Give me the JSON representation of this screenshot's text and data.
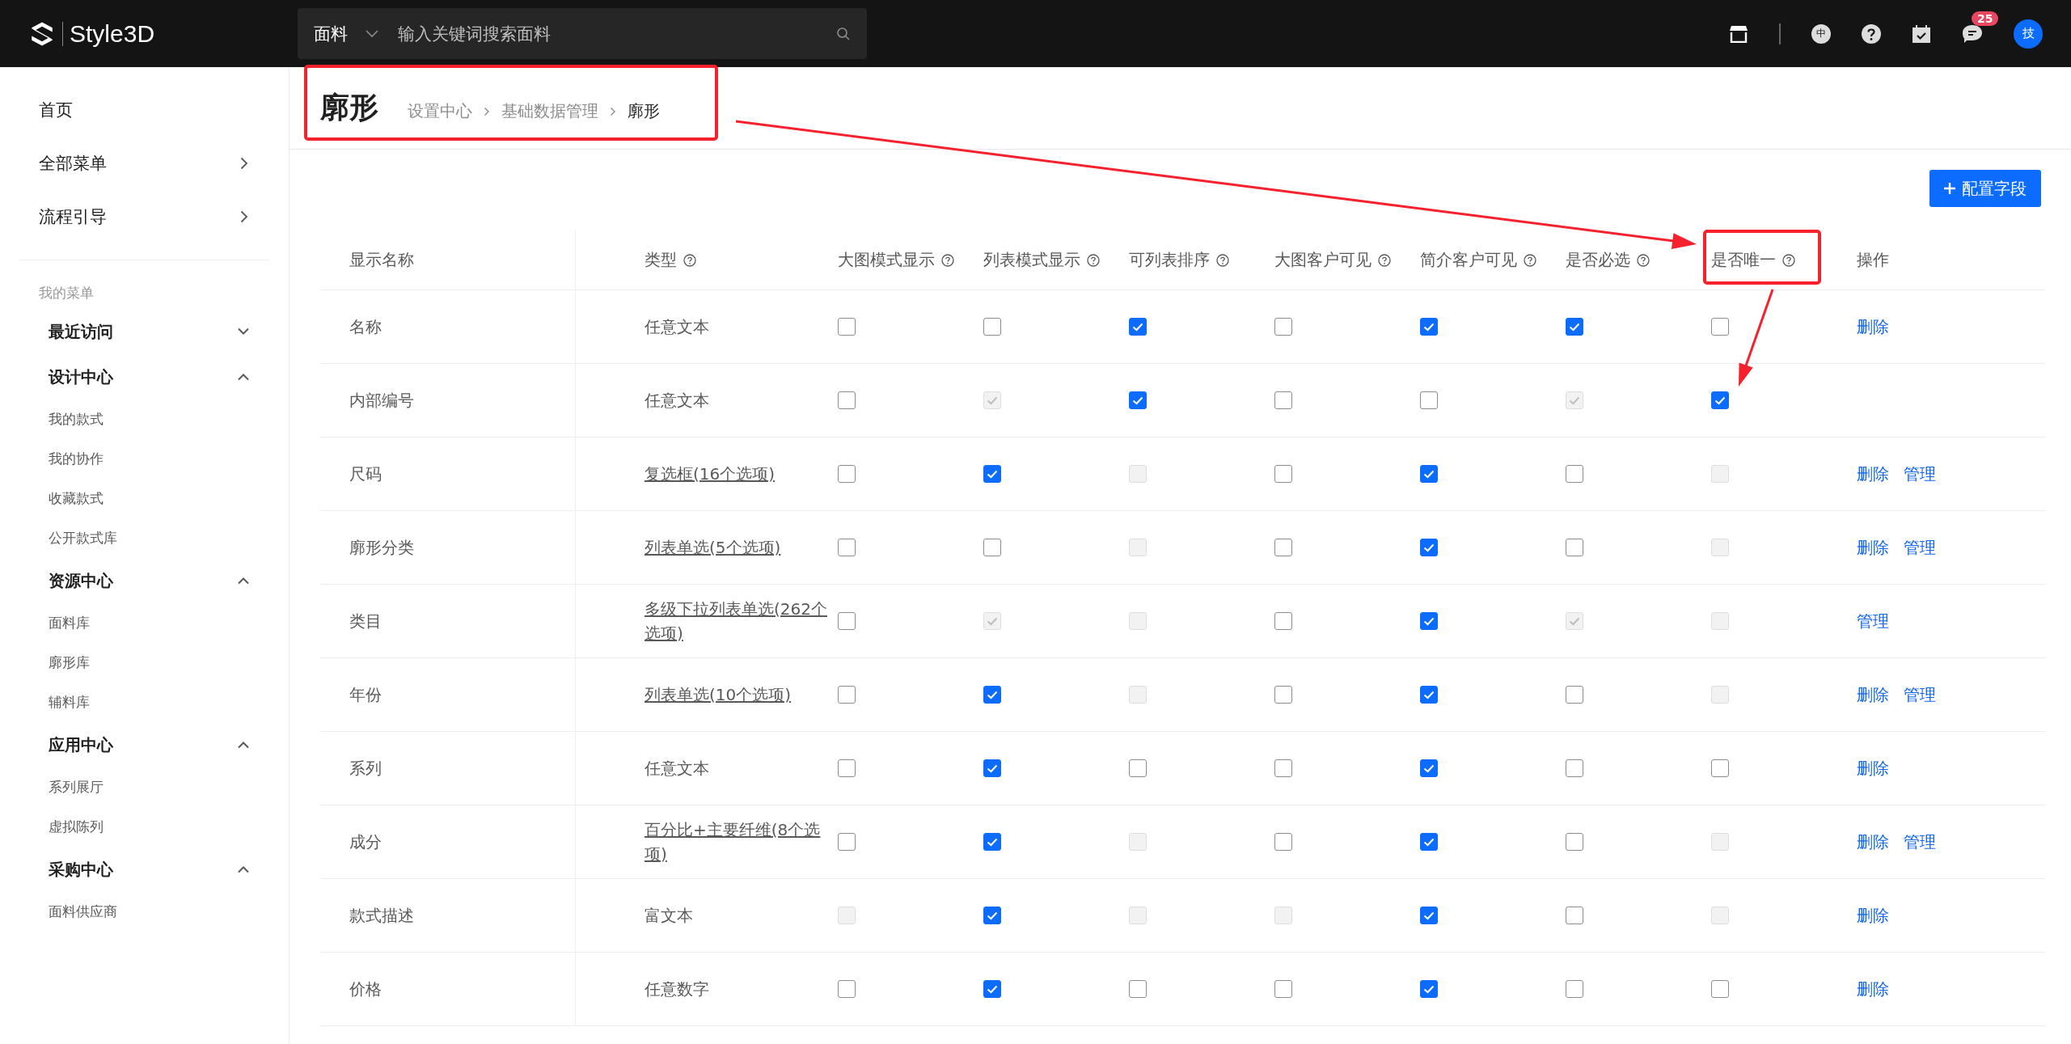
{
  "topbar": {
    "brand": "Style3D",
    "search": {
      "category": "面料",
      "placeholder": "输入关键词搜索面料"
    },
    "language": "中",
    "notification_count": "25",
    "avatar": "技"
  },
  "sidebar": {
    "top_items": [
      {
        "label": "首页",
        "has_arrow": false
      },
      {
        "label": "全部菜单",
        "has_arrow": true
      },
      {
        "label": "流程引导",
        "has_arrow": true
      }
    ],
    "section_title": "我的菜单",
    "groups": [
      {
        "label": "最近访问",
        "expanded": false
      },
      {
        "label": "设计中心",
        "expanded": true,
        "children": [
          "我的款式",
          "我的协作",
          "收藏款式",
          "公开款式库"
        ]
      },
      {
        "label": "资源中心",
        "expanded": true,
        "children": [
          "面料库",
          "廓形库",
          "辅料库"
        ]
      },
      {
        "label": "应用中心",
        "expanded": true,
        "children": [
          "系列展厅",
          "虚拟陈列"
        ]
      },
      {
        "label": "采购中心",
        "expanded": true,
        "children": [
          "面料供应商"
        ]
      }
    ]
  },
  "page": {
    "title": "廓形",
    "breadcrumb": [
      "设置中心",
      "基础数据管理",
      "廓形"
    ],
    "add_button": "配置字段"
  },
  "table": {
    "columns": [
      {
        "label": "显示名称",
        "help": false
      },
      {
        "label": "类型",
        "help": true
      },
      {
        "label": "大图模式显示",
        "help": true
      },
      {
        "label": "列表模式显示",
        "help": true
      },
      {
        "label": "可列表排序",
        "help": true
      },
      {
        "label": "大图客户可见",
        "help": true
      },
      {
        "label": "简介客户可见",
        "help": true
      },
      {
        "label": "是否必选",
        "help": true
      },
      {
        "label": "是否唯一",
        "help": true
      },
      {
        "label": "操作",
        "help": false
      }
    ],
    "rows": [
      {
        "name": "名称",
        "type": {
          "text": "任意文本",
          "kind": "text"
        },
        "checks": [
          {
            "checked": false,
            "disabled": false
          },
          {
            "checked": false,
            "disabled": false
          },
          {
            "checked": true,
            "disabled": false
          },
          {
            "checked": false,
            "disabled": false
          },
          {
            "checked": true,
            "disabled": false
          },
          {
            "checked": true,
            "disabled": false
          },
          {
            "checked": false,
            "disabled": false
          }
        ],
        "actions": [
          "删除"
        ]
      },
      {
        "name": "内部编号",
        "type": {
          "text": "任意文本",
          "kind": "text"
        },
        "checks": [
          {
            "checked": false,
            "disabled": false
          },
          {
            "checked": true,
            "disabled": true
          },
          {
            "checked": true,
            "disabled": false
          },
          {
            "checked": false,
            "disabled": false
          },
          {
            "checked": false,
            "disabled": false
          },
          {
            "checked": true,
            "disabled": true
          },
          {
            "checked": true,
            "disabled": false
          }
        ]
      },
      {
        "name": "尺码",
        "type": {
          "text": "复选框(16个选项)",
          "kind": "link"
        },
        "checks": [
          {
            "checked": false,
            "disabled": false
          },
          {
            "checked": true,
            "disabled": false
          },
          {
            "checked": false,
            "disabled": true
          },
          {
            "checked": false,
            "disabled": false
          },
          {
            "checked": true,
            "disabled": false
          },
          {
            "checked": false,
            "disabled": false
          },
          {
            "checked": false,
            "disabled": true
          }
        ],
        "actions": [
          "删除",
          "管理"
        ]
      },
      {
        "name": "廓形分类",
        "type": {
          "text": "列表单选(5个选项)",
          "kind": "link"
        },
        "checks": [
          {
            "checked": false,
            "disabled": false
          },
          {
            "checked": false,
            "disabled": false
          },
          {
            "checked": false,
            "disabled": true
          },
          {
            "checked": false,
            "disabled": false
          },
          {
            "checked": true,
            "disabled": false
          },
          {
            "checked": false,
            "disabled": false
          },
          {
            "checked": false,
            "disabled": true
          }
        ],
        "actions": [
          "删除",
          "管理"
        ]
      },
      {
        "name": "类目",
        "type": {
          "text": "多级下拉列表单选(262个选项)",
          "kind": "link"
        },
        "checks": [
          {
            "checked": false,
            "disabled": false
          },
          {
            "checked": true,
            "disabled": true
          },
          {
            "checked": false,
            "disabled": true
          },
          {
            "checked": false,
            "disabled": false
          },
          {
            "checked": true,
            "disabled": false
          },
          {
            "checked": true,
            "disabled": true
          },
          {
            "checked": false,
            "disabled": true
          }
        ],
        "actions": [
          "管理"
        ]
      },
      {
        "name": "年份",
        "type": {
          "text": "列表单选(10个选项)",
          "kind": "link"
        },
        "checks": [
          {
            "checked": false,
            "disabled": false
          },
          {
            "checked": true,
            "disabled": false
          },
          {
            "checked": false,
            "disabled": true
          },
          {
            "checked": false,
            "disabled": false
          },
          {
            "checked": true,
            "disabled": false
          },
          {
            "checked": false,
            "disabled": false
          },
          {
            "checked": false,
            "disabled": true
          }
        ],
        "actions": [
          "删除",
          "管理"
        ]
      },
      {
        "name": "系列",
        "type": {
          "text": "任意文本",
          "kind": "text"
        },
        "checks": [
          {
            "checked": false,
            "disabled": false
          },
          {
            "checked": true,
            "disabled": false
          },
          {
            "checked": false,
            "disabled": false
          },
          {
            "checked": false,
            "disabled": false
          },
          {
            "checked": true,
            "disabled": false
          },
          {
            "checked": false,
            "disabled": false
          },
          {
            "checked": false,
            "disabled": false
          }
        ],
        "actions": [
          "删除"
        ]
      },
      {
        "name": "成分",
        "type": {
          "text": "百分比+主要纤维(8个选项)",
          "kind": "link"
        },
        "checks": [
          {
            "checked": false,
            "disabled": false
          },
          {
            "checked": true,
            "disabled": false
          },
          {
            "checked": false,
            "disabled": true
          },
          {
            "checked": false,
            "disabled": false
          },
          {
            "checked": true,
            "disabled": false
          },
          {
            "checked": false,
            "disabled": false
          },
          {
            "checked": false,
            "disabled": true
          }
        ],
        "actions": [
          "删除",
          "管理"
        ]
      },
      {
        "name": "款式描述",
        "type": {
          "text": "富文本",
          "kind": "text"
        },
        "checks": [
          {
            "checked": false,
            "disabled": true
          },
          {
            "checked": true,
            "disabled": false
          },
          {
            "checked": false,
            "disabled": true
          },
          {
            "checked": false,
            "disabled": true
          },
          {
            "checked": true,
            "disabled": false
          },
          {
            "checked": false,
            "disabled": false
          },
          {
            "checked": false,
            "disabled": true
          }
        ],
        "actions": [
          "删除"
        ]
      },
      {
        "name": "价格",
        "type": {
          "text": "任意数字",
          "kind": "text"
        },
        "checks": [
          {
            "checked": false,
            "disabled": false
          },
          {
            "checked": true,
            "disabled": false
          },
          {
            "checked": false,
            "disabled": false
          },
          {
            "checked": false,
            "disabled": false
          },
          {
            "checked": true,
            "disabled": false
          },
          {
            "checked": false,
            "disabled": false
          },
          {
            "checked": false,
            "disabled": false
          }
        ],
        "actions": [
          "删除"
        ]
      }
    ]
  }
}
